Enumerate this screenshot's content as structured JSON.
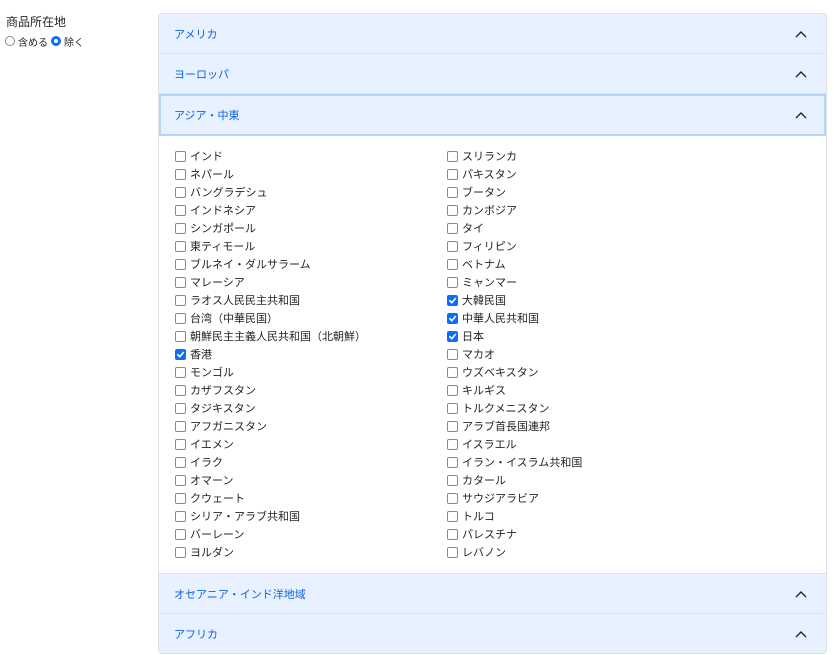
{
  "filter": {
    "label": "商品所在地",
    "include_label": "含める",
    "exclude_label": "除く",
    "selected": "exclude"
  },
  "colors": {
    "accent": "#0d6efd",
    "header_bg": "#e7f1ff",
    "header_text": "#0c63e4"
  },
  "accordion": {
    "sections": [
      {
        "label": "アメリカ",
        "expanded": false
      },
      {
        "label": "ヨーロッパ",
        "expanded": false
      },
      {
        "label": "アジア・中東",
        "expanded": true
      },
      {
        "label": "オセアニア・インド洋地域",
        "expanded": false
      },
      {
        "label": "アフリカ",
        "expanded": false
      }
    ]
  },
  "asia": {
    "left": [
      {
        "label": "インド",
        "checked": false
      },
      {
        "label": "ネパール",
        "checked": false
      },
      {
        "label": "バングラデシュ",
        "checked": false
      },
      {
        "label": "インドネシア",
        "checked": false
      },
      {
        "label": "シンガポール",
        "checked": false
      },
      {
        "label": "東ティモール",
        "checked": false
      },
      {
        "label": "ブルネイ・ダルサラーム",
        "checked": false
      },
      {
        "label": "マレーシア",
        "checked": false
      },
      {
        "label": "ラオス人民民主共和国",
        "checked": false
      },
      {
        "label": "台湾（中華民国）",
        "checked": false
      },
      {
        "label": "朝鮮民主主義人民共和国（北朝鮮）",
        "checked": false
      },
      {
        "label": "香港",
        "checked": true
      },
      {
        "label": "モンゴル",
        "checked": false
      },
      {
        "label": "カザフスタン",
        "checked": false
      },
      {
        "label": "タジキスタン",
        "checked": false
      },
      {
        "label": "アフガニスタン",
        "checked": false
      },
      {
        "label": "イエメン",
        "checked": false
      },
      {
        "label": "イラク",
        "checked": false
      },
      {
        "label": "オマーン",
        "checked": false
      },
      {
        "label": "クウェート",
        "checked": false
      },
      {
        "label": "シリア・アラブ共和国",
        "checked": false
      },
      {
        "label": "バーレーン",
        "checked": false
      },
      {
        "label": "ヨルダン",
        "checked": false
      }
    ],
    "right": [
      {
        "label": "スリランカ",
        "checked": false
      },
      {
        "label": "パキスタン",
        "checked": false
      },
      {
        "label": "ブータン",
        "checked": false
      },
      {
        "label": "カンボジア",
        "checked": false
      },
      {
        "label": "タイ",
        "checked": false
      },
      {
        "label": "フィリピン",
        "checked": false
      },
      {
        "label": "ベトナム",
        "checked": false
      },
      {
        "label": "ミャンマー",
        "checked": false
      },
      {
        "label": "大韓民国",
        "checked": true
      },
      {
        "label": "中華人民共和国",
        "checked": true
      },
      {
        "label": "日本",
        "checked": true
      },
      {
        "label": "マカオ",
        "checked": false
      },
      {
        "label": "ウズベキスタン",
        "checked": false
      },
      {
        "label": "キルギス",
        "checked": false
      },
      {
        "label": "トルクメニスタン",
        "checked": false
      },
      {
        "label": "アラブ首長国連邦",
        "checked": false
      },
      {
        "label": "イスラエル",
        "checked": false
      },
      {
        "label": "イラン・イスラム共和国",
        "checked": false
      },
      {
        "label": "カタール",
        "checked": false
      },
      {
        "label": "サウジアラビア",
        "checked": false
      },
      {
        "label": "トルコ",
        "checked": false
      },
      {
        "label": "パレスチナ",
        "checked": false
      },
      {
        "label": "レバノン",
        "checked": false
      }
    ]
  }
}
